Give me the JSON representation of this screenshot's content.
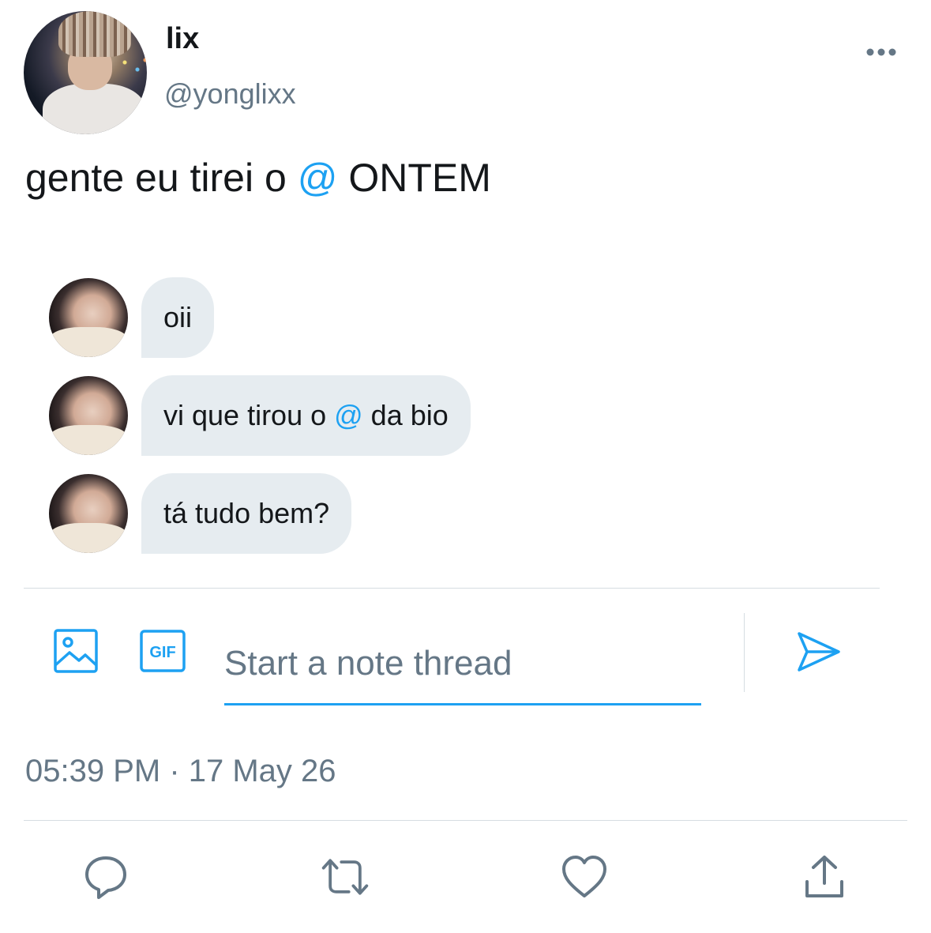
{
  "author": {
    "name": "lix",
    "handle": "@yonglixx",
    "avatar_icon": "user-avatar"
  },
  "tweet": {
    "text_before": "gente eu tirei o ",
    "mention": "@",
    "text_after": " ONTEM"
  },
  "messages": [
    {
      "text": "oii"
    },
    {
      "before": "vi que tirou o ",
      "mention": "@",
      "after": " da bio"
    },
    {
      "text": "tá tudo bem?"
    }
  ],
  "note": {
    "placeholder": "Start a note thread",
    "value": "",
    "gif_label": "GIF"
  },
  "timestamp": "05:39 PM · 17 May 26",
  "actions": [
    "reply-icon",
    "retweet-icon",
    "like-icon",
    "share-icon"
  ],
  "colors": {
    "accent": "#1da1f2",
    "secondary_text": "#657786",
    "bubble": "#e6ecf0",
    "action_icons": "#657786"
  }
}
